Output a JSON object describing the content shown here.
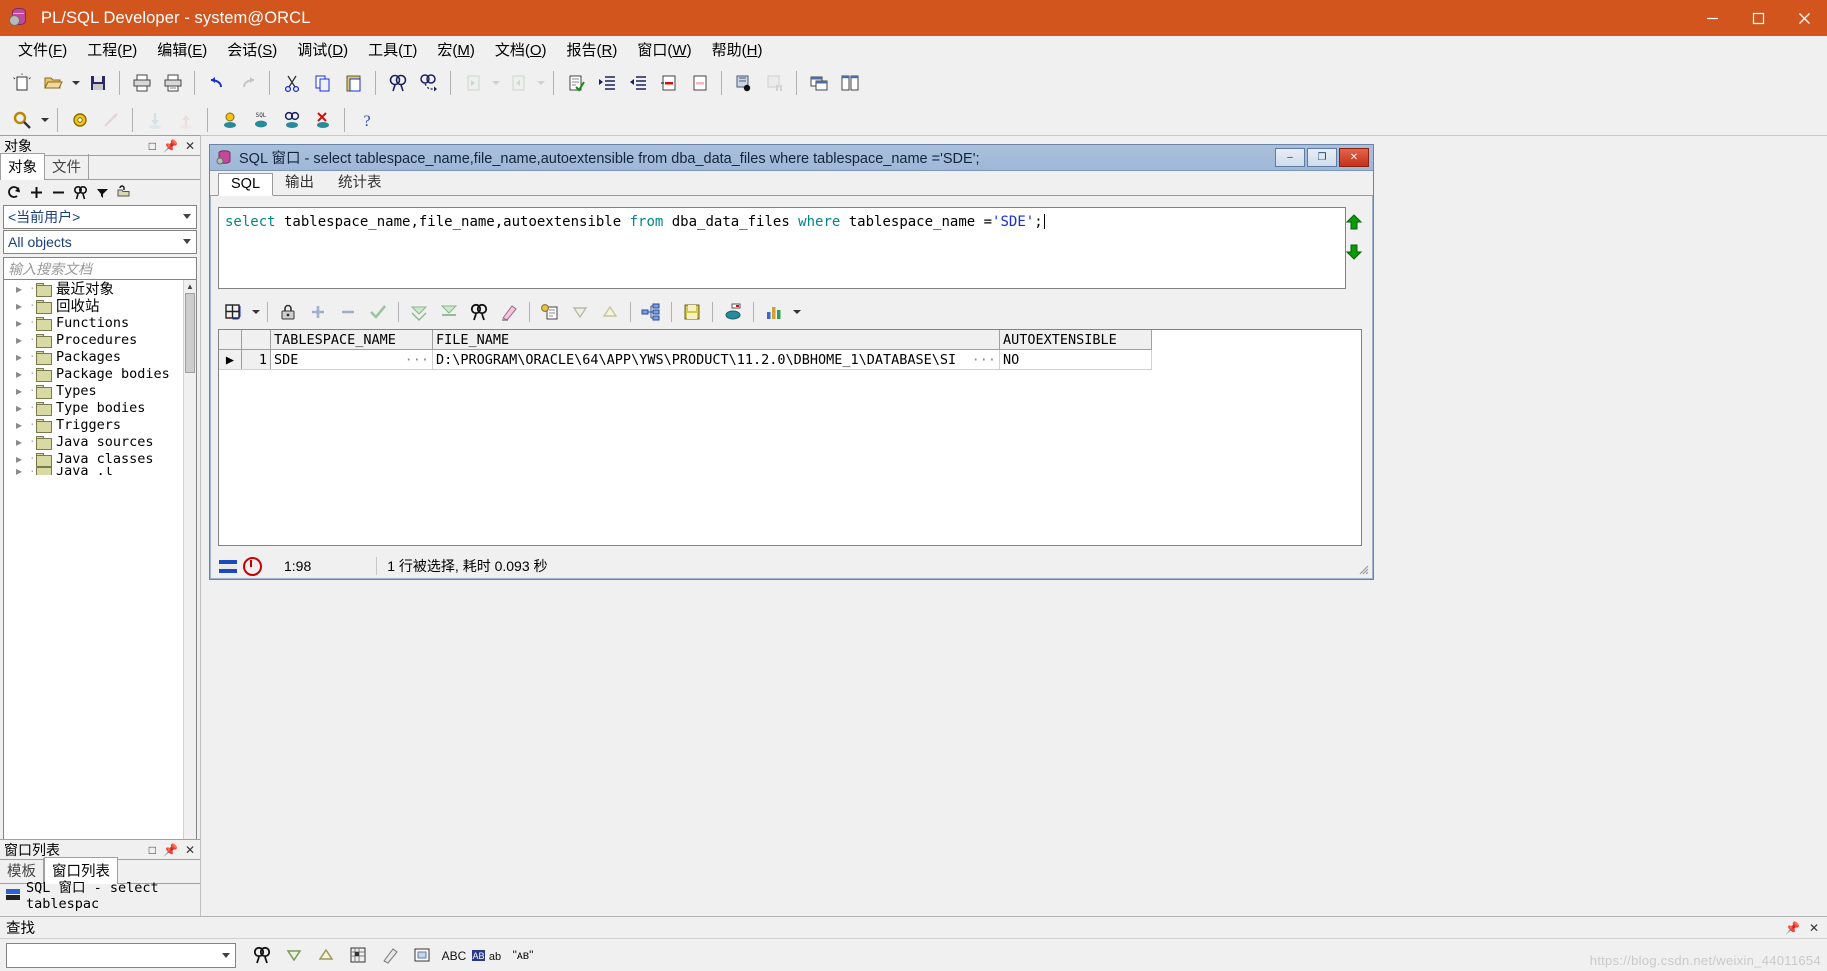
{
  "window": {
    "title": "PL/SQL Developer - system@ORCL",
    "app_icon": "database-gear-icon",
    "minimize": "minimize-button",
    "maximize": "maximize-button",
    "close": "close-button",
    "accent": "#d2551e"
  },
  "menubar": [
    {
      "label": "文件",
      "accel": "F"
    },
    {
      "label": "工程",
      "accel": "P"
    },
    {
      "label": "编辑",
      "accel": "E"
    },
    {
      "label": "会话",
      "accel": "S"
    },
    {
      "label": "调试",
      "accel": "D"
    },
    {
      "label": "工具",
      "accel": "T"
    },
    {
      "label": "宏",
      "accel": "M"
    },
    {
      "label": "文档",
      "accel": "O"
    },
    {
      "label": "报告",
      "accel": "R"
    },
    {
      "label": "窗口",
      "accel": "W"
    },
    {
      "label": "帮助",
      "accel": "H"
    }
  ],
  "toolbar_main": [
    "new-icon",
    "open-icon",
    "open-dropdown-icon",
    "save-icon",
    "sep",
    "print-icon",
    "print-preview-icon",
    "sep",
    "undo-icon",
    "redo-icon",
    "sep",
    "cut-icon",
    "copy-icon",
    "paste-icon",
    "sep",
    "find-icon",
    "find-next-icon",
    "sep",
    "prev-document-icon",
    "prev-dropdown-icon",
    "next-document-icon",
    "next-dropdown-icon",
    "sep",
    "check-syntax-icon",
    "indent-icon",
    "outdent-icon",
    "comment-icon",
    "uncomment-icon",
    "sep",
    "execute-icon",
    "break-icon",
    "sep",
    "window-list-icon",
    "tile-icon"
  ],
  "toolbar_second": [
    "query-icon",
    "query-dropdown-icon",
    "sep",
    "beautifier-icon",
    "explain-plan-icon",
    "sep",
    "import-icon",
    "export-icon",
    "sep",
    "session-icon",
    "test-sql-icon",
    "find-db-object-icon",
    "logoff-icon",
    "sep",
    "help-icon"
  ],
  "sidebar": {
    "objects_panel": {
      "title": "对象",
      "header_buttons": [
        "restore-icon",
        "pin-icon",
        "close-icon"
      ],
      "tabs": [
        {
          "label": "对象",
          "active": true
        },
        {
          "label": "文件",
          "active": false
        }
      ],
      "mini_tools": [
        "refresh-icon",
        "add-icon",
        "remove-icon",
        "find-icon",
        "filter-icon",
        "folder-icon"
      ],
      "user_filter": "<当前用户>",
      "object_filter": "All objects",
      "search_placeholder": "输入搜索文档",
      "tree": [
        {
          "label": "最近对象",
          "cjk": true
        },
        {
          "label": "回收站",
          "cjk": true
        },
        {
          "label": "Functions",
          "cjk": false
        },
        {
          "label": "Procedures",
          "cjk": false
        },
        {
          "label": "Packages",
          "cjk": false
        },
        {
          "label": "Package bodies",
          "cjk": false
        },
        {
          "label": "Types",
          "cjk": false
        },
        {
          "label": "Type bodies",
          "cjk": false
        },
        {
          "label": "Triggers",
          "cjk": false
        },
        {
          "label": "Java sources",
          "cjk": false
        },
        {
          "label": "Java classes",
          "cjk": false
        }
      ]
    },
    "windows_panel": {
      "title": "窗口列表",
      "header_buttons": [
        "restore-icon",
        "pin-icon",
        "close-icon"
      ],
      "tabs": [
        {
          "label": "模板",
          "active": false
        },
        {
          "label": "窗口列表",
          "active": true
        }
      ],
      "items": [
        {
          "label": "SQL 窗口 - select tablespac",
          "icon": "sql-window-icon"
        }
      ]
    }
  },
  "child_window": {
    "icon": "database-icon",
    "title": "SQL 窗口 - select tablespace_name,file_name,autoextensible from dba_data_files where tablespace_name ='SDE';",
    "buttons": {
      "minimize": "–",
      "maximize": "❐",
      "close": "✕"
    },
    "tabs": [
      {
        "label": "SQL",
        "active": true
      },
      {
        "label": "输出",
        "active": false
      },
      {
        "label": "统计表",
        "active": false
      }
    ],
    "editor": {
      "tokens": [
        {
          "t": "select",
          "c": "kw"
        },
        {
          "t": " tablespace_name,file_name,autoextensible ",
          "c": "plain"
        },
        {
          "t": "from",
          "c": "kw"
        },
        {
          "t": " dba_data_files ",
          "c": "plain"
        },
        {
          "t": "where",
          "c": "kw"
        },
        {
          "t": " tablespace_name =",
          "c": "plain"
        },
        {
          "t": "'SDE'",
          "c": "str"
        },
        {
          "t": ";",
          "c": "plain"
        }
      ],
      "scroll_up_icon": "scroll-up-arrow-icon",
      "scroll_down_icon": "scroll-down-arrow-icon"
    },
    "grid_toolbar": [
      "grid-layout-icon",
      "grid-layout-dropdown-icon",
      "sep",
      "lock-icon",
      "add-row-icon",
      "delete-row-icon",
      "post-changes-icon",
      "sep",
      "fetch-next-icon",
      "fetch-last-icon",
      "find-icon",
      "clear-icon",
      "sep",
      "copy-to-clipboard-icon",
      "sort-desc-icon",
      "sort-asc-icon",
      "sep",
      "query-builder-icon",
      "sep",
      "save-icon",
      "sep",
      "export-icon",
      "sep",
      "chart-icon",
      "chart-dropdown-icon"
    ],
    "result_grid": {
      "columns": [
        "TABLESPACE_NAME",
        "FILE_NAME",
        "AUTOEXTENSIBLE"
      ],
      "rows": [
        {
          "num": "1",
          "selected": true,
          "cells": [
            {
              "value": "SDE",
              "truncated": true
            },
            {
              "value": "D:\\PROGRAM\\ORACLE\\64\\APP\\YWS\\PRODUCT\\11.2.0\\DBHOME_1\\DATABASE\\SI",
              "truncated": true
            },
            {
              "value": "NO",
              "truncated": false
            }
          ]
        }
      ]
    },
    "status": {
      "cursor_position": "1:98",
      "message": "1 行被选择, 耗时 0.093 秒"
    }
  },
  "find_panel": {
    "title": "查找",
    "header_buttons": [
      "pin-icon",
      "close-icon"
    ],
    "input_value": "",
    "buttons": [
      "find-icon",
      "find-down-icon",
      "find-up-icon",
      "filter-icon",
      "highlight-icon",
      "select-icon",
      "match-case-icon",
      "whole-word-icon",
      "regex-icon"
    ]
  },
  "watermark": "https://blog.csdn.net/weixin_44011654"
}
